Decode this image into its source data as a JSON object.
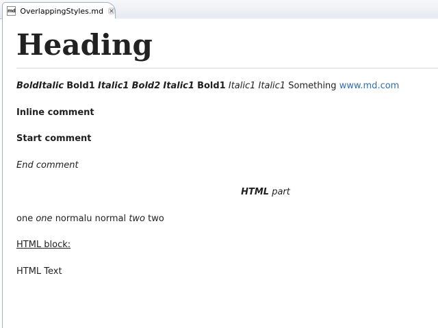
{
  "tab": {
    "icon_label": "md",
    "title": "OverlappingStyles.md"
  },
  "document": {
    "heading": "Heading",
    "styles_line": [
      {
        "text": "BoldItalic",
        "style": "bi"
      },
      {
        "text": "Bold1",
        "style": "b"
      },
      {
        "text": "Italic1",
        "style": "bi"
      },
      {
        "text": "Bold2",
        "style": "bi"
      },
      {
        "text": "Italic1",
        "style": "bi"
      },
      {
        "text": "Bold1",
        "style": "b"
      },
      {
        "text": "Italic1",
        "style": "i"
      },
      {
        "text": "Italic1",
        "style": "i"
      },
      {
        "text": "Something",
        "style": "normal"
      },
      {
        "text": "www.md.com",
        "style": "link"
      }
    ],
    "inline_comment": "Inline comment",
    "start_comment": "Start comment",
    "end_comment": "End comment",
    "html_part": {
      "bold_italic": "HTML",
      "italic": "part"
    },
    "normal_line": [
      {
        "text": "one",
        "style": "normal"
      },
      {
        "text": "one",
        "style": "i"
      },
      {
        "text": "normalu normal",
        "style": "normal"
      },
      {
        "text": "two",
        "style": "i"
      },
      {
        "text": "two",
        "style": "normal"
      }
    ],
    "html_block": "HTML block:",
    "html_text": "HTML Text"
  },
  "colors": {
    "link": "#2f6db5",
    "tab_border": "#9fb0c7"
  }
}
